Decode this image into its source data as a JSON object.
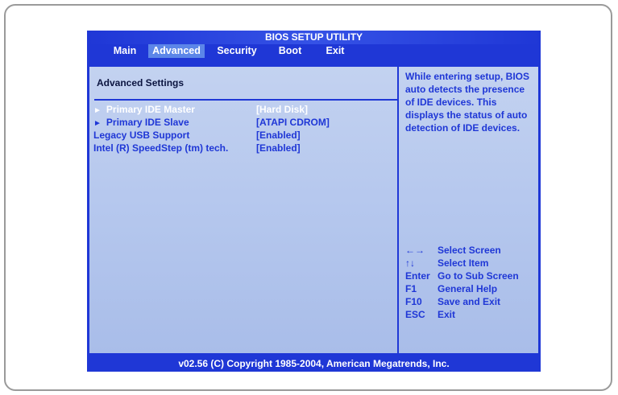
{
  "title": "BIOS SETUP UTILITY",
  "menu": [
    {
      "label": "Main",
      "active": false
    },
    {
      "label": "Advanced",
      "active": true
    },
    {
      "label": "Security",
      "active": false
    },
    {
      "label": "Boot",
      "active": false
    },
    {
      "label": "Exit",
      "active": false
    }
  ],
  "section_title": "Advanced Settings",
  "settings": [
    {
      "label": "Primary IDE Master",
      "value": "[Hard Disk]",
      "submenu": true,
      "selected": true
    },
    {
      "label": "Primary IDE Slave",
      "value": "[ATAPI CDROM]",
      "submenu": true,
      "selected": false
    },
    {
      "label": "Legacy USB Support",
      "value": "[Enabled]",
      "submenu": false,
      "selected": false
    },
    {
      "label": "Intel (R) SpeedStep (tm) tech.",
      "value": "[Enabled]",
      "submenu": false,
      "selected": false
    }
  ],
  "help_text": "While entering setup, BIOS auto detects the presence of IDE devices.  This displays the status of auto detection of IDE devices.",
  "keys": [
    {
      "key": "←→",
      "desc": "Select Screen",
      "icon": "left-right-arrow-icon"
    },
    {
      "key": "↑↓",
      "desc": "Select Item",
      "icon": "up-down-arrow-icon"
    },
    {
      "key": "Enter",
      "desc": "Go to Sub Screen"
    },
    {
      "key": "F1",
      "desc": "General Help"
    },
    {
      "key": "F10",
      "desc": "Save and Exit"
    },
    {
      "key": "ESC",
      "desc": "Exit"
    }
  ],
  "footer": "v02.56 (C) Copyright  1985-2004, American Megatrends, Inc.",
  "colors": {
    "bios_blue": "#1f37d6",
    "panel": "#b6c8ee",
    "active_tab": "#5c86e8"
  }
}
